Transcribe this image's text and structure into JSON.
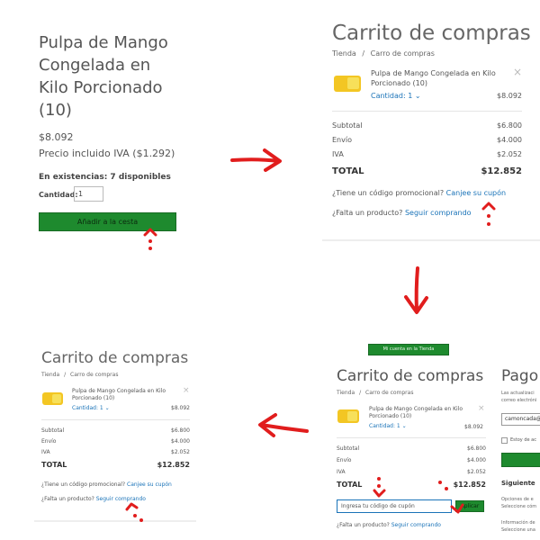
{
  "p1": {
    "title_lines": [
      "Pulpa de Mango",
      "Congelada en",
      "Kilo Porcionado",
      "(10)"
    ],
    "price": "$8.092",
    "tax_note": "Precio incluido IVA ($1.292)",
    "stock": "En existencias: 7 disponibles",
    "qty_label": "Cantidad:",
    "qty_value": "1",
    "add_button": "Añadir a la cesta"
  },
  "p2": {
    "title": "Carrito de compras",
    "breadcrumb_home": "Tienda",
    "breadcrumb_sep": "/",
    "breadcrumb_current": "Carro de compras",
    "item_name_l1": "Pulpa de Mango Congelada en Kilo",
    "item_name_l2": "Porcionado (10)",
    "qty": "Cantidad: 1",
    "item_price": "$8.092",
    "close": "×",
    "subtotal_label": "Subtotal",
    "subtotal": "$6.800",
    "shipping_label": "Envío",
    "shipping": "$4.000",
    "tax_label": "IVA",
    "tax": "$2.052",
    "total_label": "TOTAL",
    "total": "$12.852",
    "promo_q": "¿Tiene un código promocional?",
    "promo_link": "Canjee su cupón",
    "missing_q": "¿Falta un producto?",
    "missing_link": "Seguir comprando"
  },
  "p4": {
    "top_button": "Mi cuenta en la Tienda",
    "title": "Carrito de compras",
    "breadcrumb_home": "Tienda",
    "breadcrumb_sep": "/",
    "breadcrumb_current": "Carro de compras",
    "item_name_l1": "Pulpa de Mango Congelada en Kilo",
    "item_name_l2": "Porcionado (10)",
    "qty": "Cantidad: 1",
    "item_price": "$8.092",
    "close": "×",
    "subtotal_label": "Subtotal",
    "subtotal": "$6.800",
    "shipping_label": "Envío",
    "shipping": "$4.000",
    "tax_label": "IVA",
    "tax": "$2.052",
    "total_label": "TOTAL",
    "total": "$12.852",
    "coupon_placeholder": "Ingresa tu código de cupón",
    "apply_button": "Aplicar",
    "missing_q": "¿Falta un producto?",
    "missing_link": "Seguir comprando",
    "pago_title": "Pago",
    "pago_note_l1": "Las actualizaci",
    "pago_note_l2": "correo electróni",
    "email_value": "camoncada@",
    "checkbox_label": "Estoy de ac",
    "siguiente": "Siguiente",
    "opt_l1": "Opciones de e",
    "opt_l2": "Seleccione cóm",
    "info_l1": "Información de",
    "info_l2": "Seleccione una"
  },
  "p3": {
    "title": "Carrito de compras",
    "breadcrumb_home": "Tienda",
    "breadcrumb_sep": "/",
    "breadcrumb_current": "Carro de compras",
    "item_name_l1": "Pulpa de Mango Congelada en Kilo",
    "item_name_l2": "Porcionado (10)",
    "qty": "Cantidad: 1",
    "item_price": "$8.092",
    "close": "×",
    "subtotal_label": "Subtotal",
    "subtotal": "$6.800",
    "shipping_label": "Envío",
    "shipping": "$4.000",
    "tax_label": "IVA",
    "tax": "$2.052",
    "total_label": "TOTAL",
    "total": "$12.852",
    "promo_q": "¿Tiene un código promocional?",
    "promo_link": "Canjee su cupón",
    "missing_q": "¿Falta un producto?",
    "missing_link": "Seguir comprando"
  },
  "annotation_color": "#e11d1d",
  "accent_green": "#1e8a2e",
  "link_color": "#1a73b8"
}
